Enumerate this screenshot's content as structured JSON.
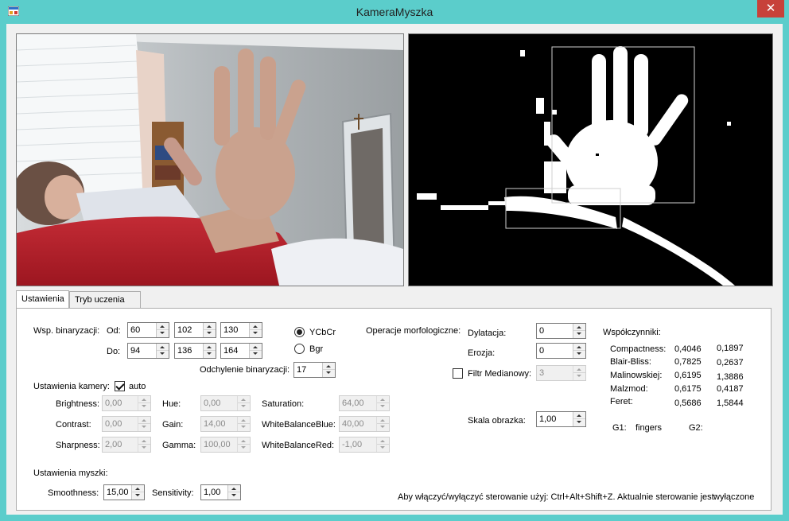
{
  "window": {
    "title": "KameraMyszka",
    "close_glyph": "✕"
  },
  "tabs": [
    {
      "label": "Ustawienia",
      "active": true
    },
    {
      "label": "Tryb uczenia",
      "active": false
    }
  ],
  "binarization": {
    "label": "Wsp. binaryzacji:",
    "from_label": "Od:",
    "to_label": "Do:",
    "from_values": [
      "60",
      "102",
      "130"
    ],
    "to_values": [
      "94",
      "136",
      "164"
    ],
    "deviation_label": "Odchylenie binaryzacji:",
    "deviation_value": "17",
    "color_spaces": [
      {
        "label": "YCbCr",
        "selected": true
      },
      {
        "label": "Bgr",
        "selected": false
      }
    ]
  },
  "camera": {
    "label": "Ustawienia kamery:",
    "auto_label": "auto",
    "auto_checked": true,
    "brightness": {
      "label": "Brightness:",
      "value": "0,00"
    },
    "contrast": {
      "label": "Contrast:",
      "value": "0,00"
    },
    "sharpness": {
      "label": "Sharpness:",
      "value": "2,00"
    },
    "hue": {
      "label": "Hue:",
      "value": "0,00"
    },
    "gain": {
      "label": "Gain:",
      "value": "14,00"
    },
    "gamma": {
      "label": "Gamma:",
      "value": "100,00"
    },
    "saturation": {
      "label": "Saturation:",
      "value": "64,00"
    },
    "wb_blue": {
      "label": "WhiteBalanceBlue:",
      "value": "40,00"
    },
    "wb_red": {
      "label": "WhiteBalanceRed:",
      "value": "-1,00"
    }
  },
  "morphology": {
    "label": "Operacje morfologiczne:",
    "dilation_label": "Dylatacja:",
    "dilation_value": "0",
    "erosion_label": "Erozja:",
    "erosion_value": "0",
    "median_label": "Filtr Medianowy:",
    "median_checked": false,
    "median_value": "3",
    "scale_label": "Skala obrazka:",
    "scale_value": "1,00"
  },
  "coefficients": {
    "title": "Współczynniki:",
    "rows": [
      {
        "name": "Compactness:",
        "v1": "0,4046",
        "v2": "0,1897"
      },
      {
        "name": "Blair-Bliss:",
        "v1": "0,7825",
        "v2": "0,2637"
      },
      {
        "name": "Malinowskiej:",
        "v1": "0,6195",
        "v2": "1,3886"
      },
      {
        "name": "Malzmod:",
        "v1": "0,6175",
        "v2": "0,4187"
      },
      {
        "name": "Feret:",
        "v1": "0,5686",
        "v2": "1,5844"
      }
    ],
    "g1_label": "G1:",
    "g1_value": "fingers",
    "g2_label": "G2:",
    "g2_value": ""
  },
  "mouse": {
    "label": "Ustawienia myszki:",
    "smoothness_label": "Smoothness:",
    "smoothness_value": "15,00",
    "sensitivity_label": "Sensitivity:",
    "sensitivity_value": "1,00"
  },
  "status": {
    "hint": "Aby włączyć/wyłączyć sterowanie użyj: Ctrl+Alt+Shift+Z. Aktualnie sterowanie jest:",
    "state": "wyłączone"
  },
  "colors": {
    "window_frame": "#5bcdcb",
    "close_button": "#c7413a",
    "client_bg": "#f0f0f0"
  },
  "icons": [
    "app-icon",
    "close-icon",
    "spin-up-icon",
    "spin-down-icon"
  ]
}
